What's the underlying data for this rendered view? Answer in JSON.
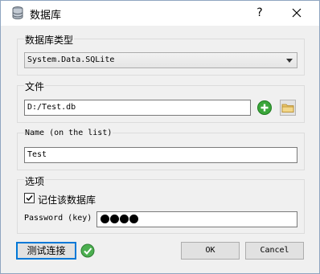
{
  "window": {
    "title": "数据库",
    "help_label": "?",
    "close_label": "✕"
  },
  "db_type": {
    "label": "数据库类型",
    "selected": "System.Data.SQLite"
  },
  "file": {
    "label": "文件",
    "value": "D:/Test.db"
  },
  "name": {
    "label": "Name (on the list)",
    "value": "Test"
  },
  "options": {
    "label": "选项",
    "remember_label": "记住该数据库",
    "remember_checked": true,
    "password_label": "Password (key)",
    "password_mask_count": 4
  },
  "buttons": {
    "test": "测试连接",
    "ok": "OK",
    "cancel": "Cancel"
  },
  "icons": {
    "title": "database-icon",
    "add": "add-icon",
    "browse": "folder-icon",
    "status": "check-icon"
  },
  "colors": {
    "accent": "#0078d7",
    "add_green": "#3aa63a",
    "check_green": "#4caf50",
    "folder": "#e8c46a"
  }
}
